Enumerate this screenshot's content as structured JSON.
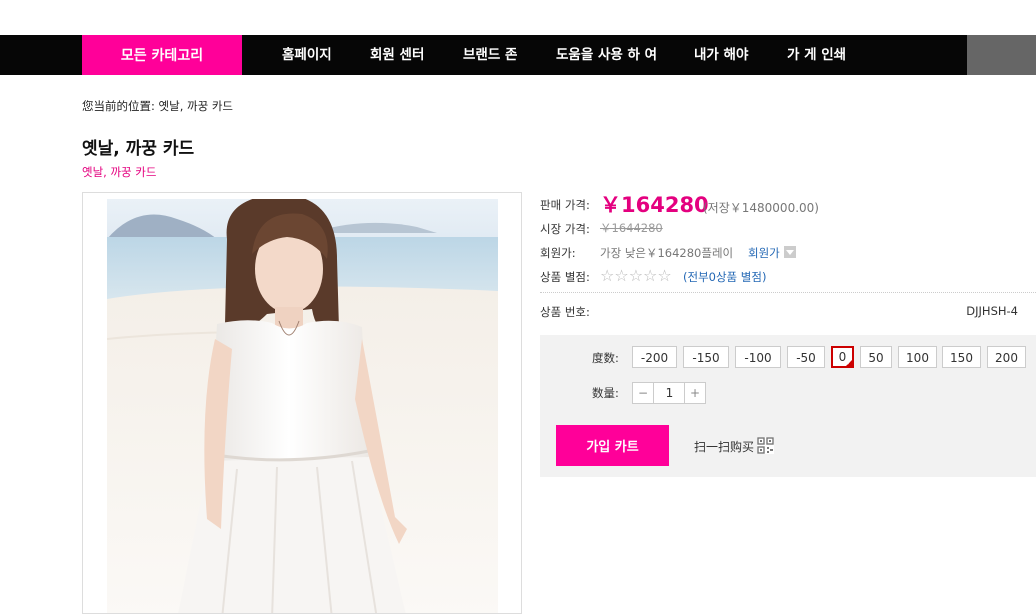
{
  "nav": {
    "all_categories": "모든 카테고리",
    "items": [
      "홈페이지",
      "회원 센터",
      "브랜드 존",
      "도움을 사용 하 여",
      "내가 해야",
      "가 게 인쇄"
    ],
    "accent": "#ff0099"
  },
  "breadcrumb": {
    "prefix": "您当前的位置:",
    "current": "옛날, 까꿍 카드"
  },
  "product": {
    "title": "옛날, 까꿍 카드",
    "subtitle": "옛날, 까꿍 카드",
    "sale_price_label": "판매 가격:",
    "sale_price": "￥164280",
    "savings": "(저장￥1480000.00)",
    "market_price_label": "시장 가격:",
    "market_price": "￥1644280",
    "member_price_label": "회원가:",
    "member_price_text": "가장 낮은￥164280플레이",
    "member_price_link": "회원가",
    "rating_label": "상품 별점:",
    "rating_stars": "☆☆☆☆☆",
    "rating_value": 0,
    "rating_link": "(전부0상품 별점)",
    "sku_label": "상품 번호:",
    "sku_value": "DJJHSH-4"
  },
  "options": {
    "degree_label": "度数:",
    "degree_values": [
      "-200",
      "-150",
      "-100",
      "-50",
      "0",
      "50",
      "100",
      "150",
      "200"
    ],
    "selected_degree": "0",
    "quantity_label": "数量:",
    "quantity_minus": "−",
    "quantity_value": "1",
    "quantity_plus": "+"
  },
  "actions": {
    "add_to_cart": "가입 카트",
    "scan_to_buy": "扫一扫购买"
  }
}
